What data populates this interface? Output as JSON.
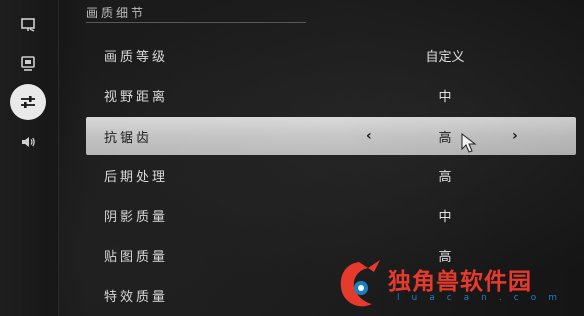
{
  "sidebar": {
    "items": [
      {
        "icon": "display-icon",
        "active": false
      },
      {
        "icon": "monitor-icon",
        "active": false
      },
      {
        "icon": "sliders-icon",
        "active": true
      },
      {
        "icon": "speaker-icon",
        "active": false
      }
    ]
  },
  "section": {
    "title": "画质细节"
  },
  "settings": [
    {
      "label": "画质等级",
      "value": "自定义"
    },
    {
      "label": "视野距离",
      "value": "中"
    },
    {
      "label": "抗锯齿",
      "value": "高",
      "selected": true
    },
    {
      "label": "后期处理",
      "value": "高"
    },
    {
      "label": "阴影质量",
      "value": "中"
    },
    {
      "label": "贴图质量",
      "value": "高"
    },
    {
      "label": "特效质量",
      "value": ""
    }
  ],
  "selector": {
    "left_arrow": "‹",
    "right_arrow": "›"
  },
  "watermark": {
    "brand": "独角兽软件园",
    "url": "luacan.com"
  },
  "colors": {
    "selected_row": "#c8c8c8",
    "active_sidebar": "#e9e9e9",
    "watermark_red": "#e63a2d",
    "watermark_blue": "#1a7fc4"
  }
}
